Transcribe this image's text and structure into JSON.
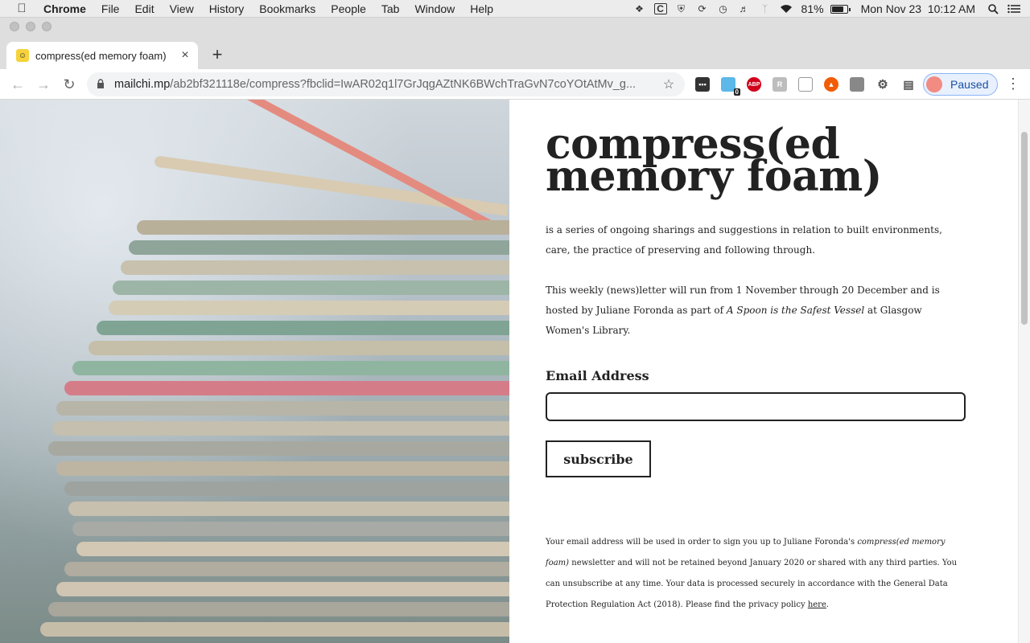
{
  "menubar": {
    "items": [
      "Chrome",
      "File",
      "Edit",
      "View",
      "History",
      "Bookmarks",
      "People",
      "Tab",
      "Window",
      "Help"
    ],
    "battery_percent": "81%",
    "battery_level": 0.81,
    "clock": "Mon Nov 23  10:12 AM",
    "tray_icons": [
      "dropbox-icon",
      "c-icon",
      "shield-icon",
      "sync-icon",
      "time-machine-icon",
      "volume-icon",
      "bluetooth-icon",
      "wifi-icon",
      "battery-icon",
      "spotlight-icon",
      "notification-list-icon"
    ]
  },
  "tab": {
    "title": "compress(ed memory foam)",
    "favicon": "mailchimp-icon"
  },
  "toolbar": {
    "url_host": "mailchi.mp",
    "url_path": "/ab2bf321118e/compress?fbclid=IwAR02q1l7GrJqgAZtNK6BWchTraGvN7coYOtAtMv_g...",
    "profile_label": "Paused",
    "extension_badge": "0",
    "abp_label": "ABP"
  },
  "page": {
    "title_line1": "compress(ed",
    "title_line2": "memory foam)",
    "intro": "is a series of ongoing sharings and suggestions in relation to built environments, care, the practice of preserving and following through.",
    "desc_before": "This weekly (news)letter will run from 1 November through 20 December and is hosted by Juliane Foronda as part of ",
    "desc_italic": "A Spoon is the Safest Vessel",
    "desc_after": " at Glasgow Women's Library.",
    "email_label": "Email Address",
    "email_value": "",
    "subscribe_label": "subscribe",
    "fine_before": "Your email address will be used in order to sign you up to Juliane Foronda's ",
    "fine_italic": "compress(ed memory foam)",
    "fine_after": " newsletter and will not be retained beyond January 2020 or shared with any third parties. You can unsubscribe at any time. Your data is processed securely in accordance with the General Data Protection Regulation Act (2018). Please find the privacy policy ",
    "fine_link": "here",
    "fine_end": "."
  }
}
